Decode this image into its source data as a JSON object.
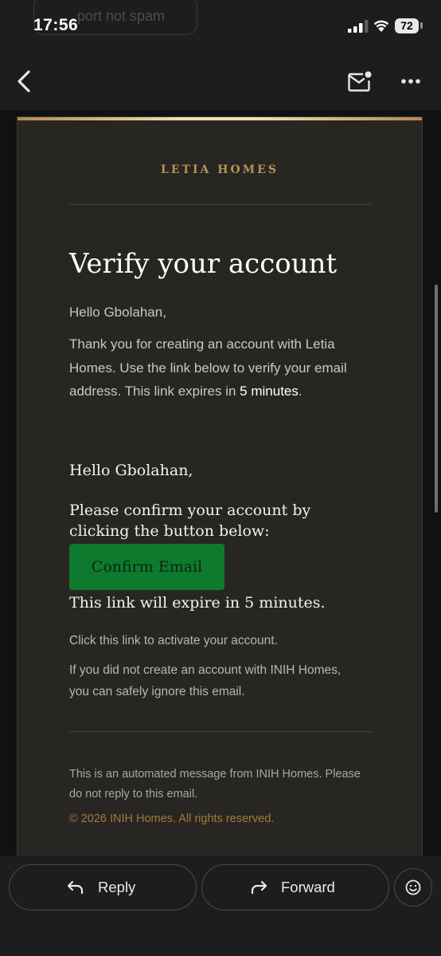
{
  "status_bar": {
    "time": "17:56",
    "battery": "72",
    "ghost_text": "port not spam"
  },
  "email": {
    "brand": "LETIA HOMES",
    "title": "Verify your account",
    "greeting": "Hello Gbolahan,",
    "intro_before": "Thank you for creating an account with Letia Homes. Use the link below to verify your email address. This link expires in ",
    "intro_minutes": "5 minutes",
    "intro_after": ".",
    "greeting2": "Hello Gbolahan,",
    "confirm_prompt": "Please confirm your account by clicking the button below:",
    "confirm_button": "Confirm Email",
    "expire_note": "This link will expire in 5 minutes.",
    "activate_note": "Click this link to activate your account.",
    "ignore_note": "If you did not create an account with INIH Homes, you can safely ignore this email.",
    "footer_note": "This is an automated message from INIH Homes. Please do not reply to this email.",
    "copyright": "© 2026 INIH Homes. All rights reserved."
  },
  "actions": {
    "reply": "Reply",
    "forward": "Forward"
  },
  "icons": {
    "back": "back-arrow-icon",
    "mark_unread": "mark-unread-mail-icon",
    "more": "more-options-icon",
    "reply": "reply-icon",
    "forward": "forward-icon",
    "emoji": "emoji-reaction-icon"
  },
  "colors": {
    "brand_gold": "#b89253",
    "confirm_button": "#0e7a2e",
    "copyright": "#a6783c",
    "card_background": "#272623"
  }
}
